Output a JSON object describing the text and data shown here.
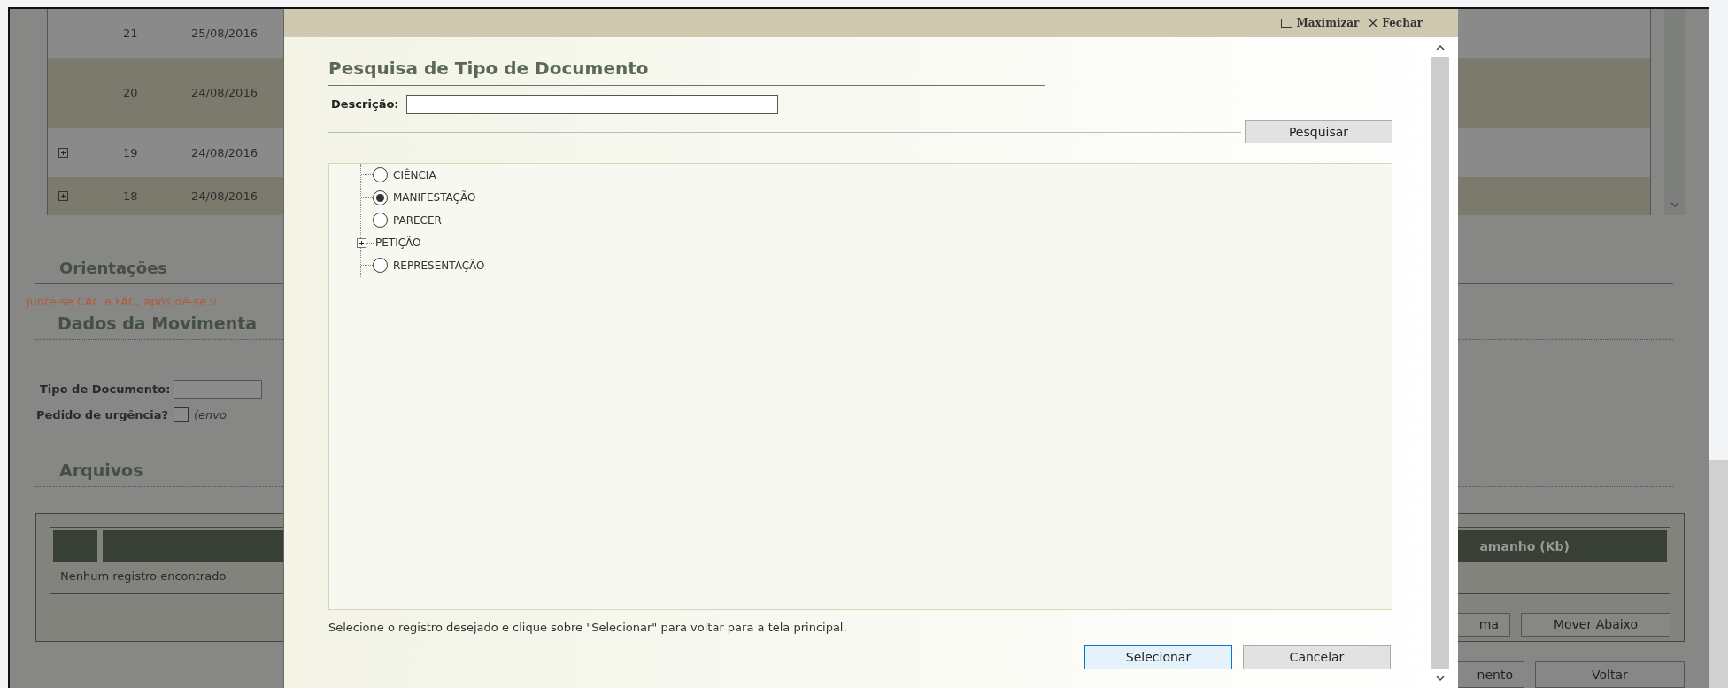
{
  "background": {
    "table": {
      "rows": [
        {
          "expandable": false,
          "number": "21",
          "date": "25/08/2016"
        },
        {
          "expandable": false,
          "number": "20",
          "date": "24/08/2016"
        },
        {
          "expandable": true,
          "number": "19",
          "date": "24/08/2016"
        },
        {
          "expandable": true,
          "number": "18",
          "date": "24/08/2016"
        }
      ]
    },
    "orientacoes": {
      "heading": "Orientações",
      "note": "Junte-se CAC e FAC, após dê-se v"
    },
    "dados": {
      "heading": "Dados da Movimenta",
      "tipo_label": "Tipo de Documento:",
      "urgencia_label": "Pedido de urgência?",
      "urgencia_checked": false,
      "urgencia_hint": "(envo"
    },
    "arquivos": {
      "heading": "Arquivos",
      "column": "amanho (Kb)",
      "empty": "Nenhum registro encontrado",
      "buttons": [
        "ma",
        "Mover Abaixo"
      ]
    },
    "footer_buttons": [
      "nento",
      "Voltar"
    ]
  },
  "modal": {
    "title_bar": {
      "maximize": "Maximizar",
      "close": "Fechar"
    },
    "title": "Pesquisa de Tipo de Documento",
    "description_label": "Descrição:",
    "search_button": "Pesquisar",
    "tree": [
      {
        "kind": "radio",
        "label": "CIÊNCIA",
        "selected": false
      },
      {
        "kind": "radio",
        "label": "MANIFESTAÇÃO",
        "selected": true
      },
      {
        "kind": "radio",
        "label": "PARECER",
        "selected": false
      },
      {
        "kind": "branch",
        "label": "PETIÇÃO",
        "expanded": false
      },
      {
        "kind": "radio",
        "label": "REPRESENTAÇÃO",
        "selected": false
      }
    ],
    "hint": "Selecione o registro desejado e clique sobre \"Selecionar\" para voltar para a tela principal.",
    "buttons": [
      {
        "label": "Selecionar",
        "primary": true
      },
      {
        "label": "Cancelar",
        "primary": false
      }
    ]
  }
}
